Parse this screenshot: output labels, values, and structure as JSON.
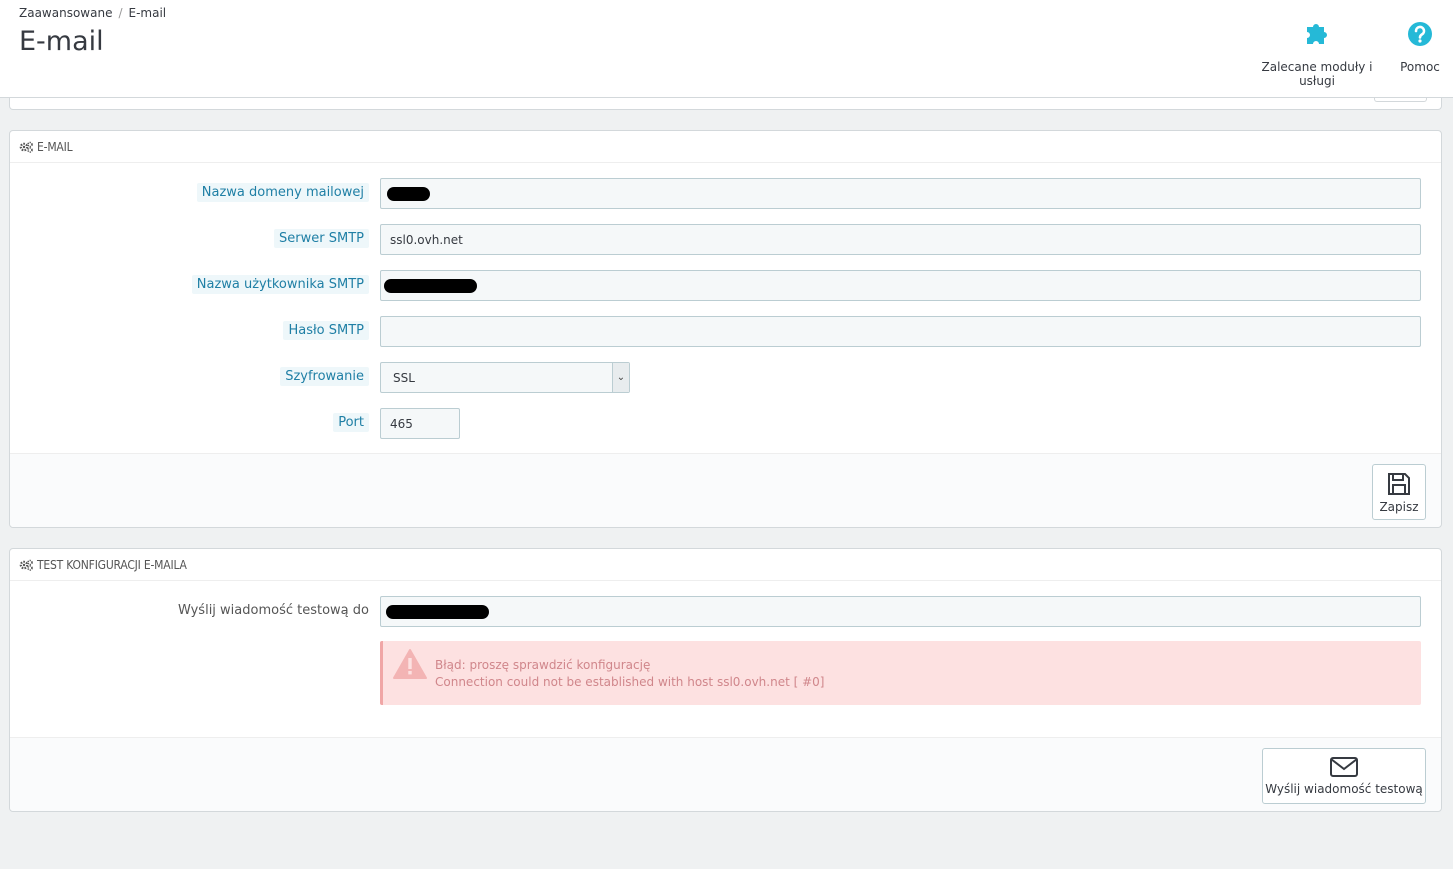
{
  "breadcrumb": {
    "parent": "Zaawansowane",
    "separator": "/",
    "current": "E-mail"
  },
  "page_title": "E-mail",
  "toolbar": {
    "modules_label": "Zalecane moduły i usługi",
    "help_label": "Pomoc"
  },
  "email_panel": {
    "title": "E-MAIL",
    "fields": {
      "domain_label": "Nazwa domeny mailowej",
      "smtp_server_label": "Serwer SMTP",
      "smtp_server_value": "ssl0.ovh.net",
      "smtp_user_label": "Nazwa użytkownika SMTP",
      "smtp_password_label": "Hasło SMTP",
      "encryption_label": "Szyfrowanie",
      "encryption_value": "SSL",
      "port_label": "Port",
      "port_value": "465"
    },
    "save_label": "Zapisz"
  },
  "test_panel": {
    "title": "TEST KONFIGURACJI E-MAILA",
    "send_to_label": "Wyślij wiadomość testową do",
    "error_title": "Błąd: proszę sprawdzić konfigurację",
    "error_detail": "Connection could not be established with host ssl0.ovh.net [ #0]",
    "send_button_label": "Wyślij wiadomość testową"
  },
  "colors": {
    "accent": "#25b9d7",
    "error_bg": "#fde1e1",
    "error_text": "#d0868b"
  }
}
